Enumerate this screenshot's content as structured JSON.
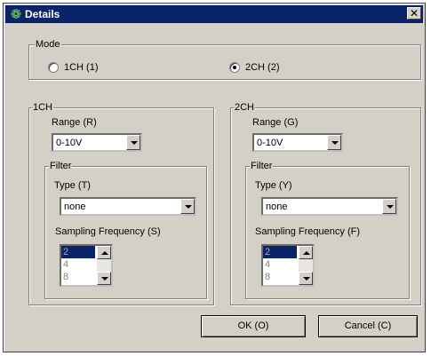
{
  "window": {
    "title": "Details",
    "icon": "gear-icon",
    "close": "✕"
  },
  "mode": {
    "label": "Mode",
    "options": [
      {
        "label": "1CH (1)",
        "selected": false
      },
      {
        "label": "2CH (2)",
        "selected": true
      }
    ]
  },
  "ch1": {
    "label": "1CH",
    "range_label": "Range (R)",
    "range_value": "0-10V",
    "filter": {
      "label": "Filter",
      "type_label": "Type (T)",
      "type_value": "none",
      "freq_label": "Sampling Frequency (S)",
      "freq_options": [
        "2",
        "4",
        "8"
      ],
      "freq_selected": "2"
    }
  },
  "ch2": {
    "label": "2CH",
    "range_label": "Range (G)",
    "range_value": "0-10V",
    "filter": {
      "label": "Filter",
      "type_label": "Type (Y)",
      "type_value": "none",
      "freq_label": "Sampling Frequency (F)",
      "freq_options": [
        "2",
        "4",
        "8"
      ],
      "freq_selected": "2"
    }
  },
  "buttons": {
    "ok": "OK (O)",
    "cancel": "Cancel (C)"
  },
  "colors": {
    "titlebar": "#0a246a",
    "face": "#d4d0c8",
    "selection": "#0a246a"
  }
}
